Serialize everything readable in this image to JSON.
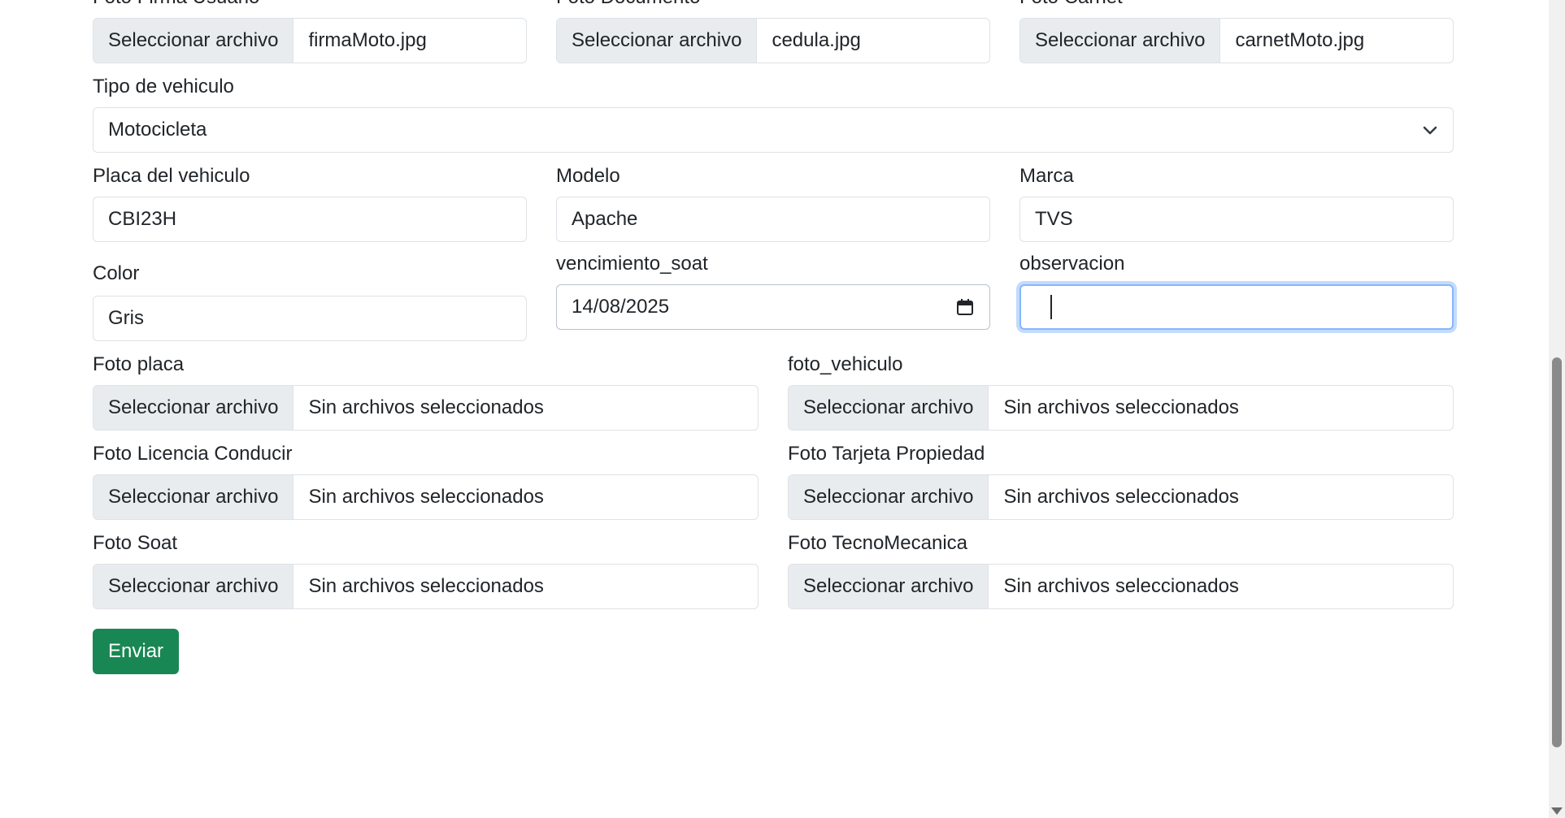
{
  "files_top": [
    {
      "label": "Foto Firma Usuario",
      "button": "Seleccionar archivo",
      "file": "firmaMoto.jpg"
    },
    {
      "label": "Foto Documento",
      "button": "Seleccionar archivo",
      "file": "cedula.jpg"
    },
    {
      "label": "Foto Carnet",
      "button": "Seleccionar archivo",
      "file": "carnetMoto.jpg"
    }
  ],
  "tipo_vehiculo": {
    "label": "Tipo de vehiculo",
    "value": "Motocicleta"
  },
  "placa": {
    "label": "Placa del vehiculo",
    "value": "CBI23H"
  },
  "modelo": {
    "label": "Modelo",
    "value": "Apache"
  },
  "marca": {
    "label": "Marca",
    "value": "TVS"
  },
  "color": {
    "label": "Color",
    "value": "Gris"
  },
  "vencimiento_soat": {
    "label": "vencimiento_soat",
    "value": "14/08/2025"
  },
  "observacion": {
    "label": "observacion",
    "value": ""
  },
  "files_bottom": [
    {
      "label": "Foto placa",
      "button": "Seleccionar archivo",
      "file": "Sin archivos seleccionados"
    },
    {
      "label": "foto_vehiculo",
      "button": "Seleccionar archivo",
      "file": "Sin archivos seleccionados"
    },
    {
      "label": "Foto Licencia Conducir",
      "button": "Seleccionar archivo",
      "file": "Sin archivos seleccionados"
    },
    {
      "label": "Foto Tarjeta Propiedad",
      "button": "Seleccionar archivo",
      "file": "Sin archivos seleccionados"
    },
    {
      "label": "Foto Soat",
      "button": "Seleccionar archivo",
      "file": "Sin archivos seleccionados"
    },
    {
      "label": "Foto TecnoMecanica",
      "button": "Seleccionar archivo",
      "file": "Sin archivos seleccionados"
    }
  ],
  "submit_label": "Enviar",
  "colors": {
    "submit": "#198754",
    "focus_ring": "#86b7fe",
    "file_button_bg": "#e9ecef"
  }
}
